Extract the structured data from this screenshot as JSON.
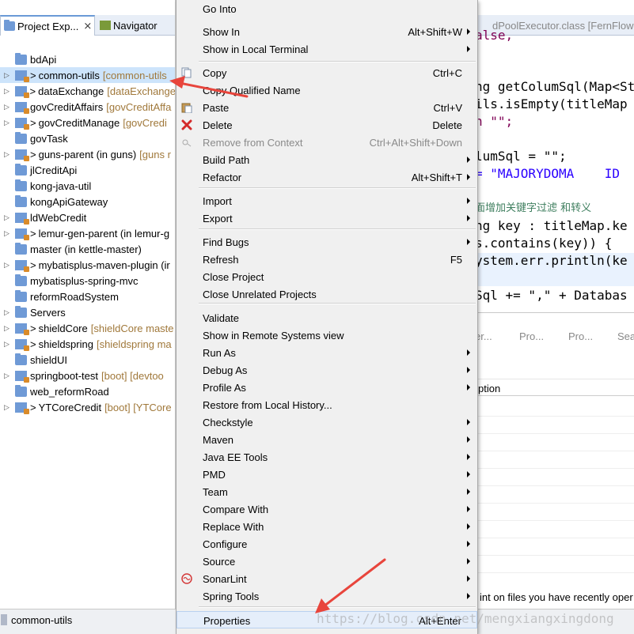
{
  "explorer": {
    "tab_project": "Project Exp...",
    "tab_close": "⨯",
    "tab_navigator": "Navigator",
    "items": [
      {
        "name": "bdApi",
        "extra": "",
        "gt": "",
        "expandable": false,
        "icon": "folder"
      },
      {
        "name": "common-utils",
        "extra": "[common-utils",
        "gt": ">",
        "expandable": true,
        "icon": "maven-project",
        "selected": true
      },
      {
        "name": "dataExchange",
        "extra": "[dataExchange",
        "gt": ">",
        "expandable": true,
        "icon": "maven-project"
      },
      {
        "name": "govCreditAffairs",
        "extra": "[govCreditAffa",
        "gt": "",
        "expandable": true,
        "icon": "maven-project"
      },
      {
        "name": "govCreditManage",
        "extra": "[govCredi",
        "gt": ">",
        "expandable": true,
        "icon": "maven-project"
      },
      {
        "name": "govTask",
        "extra": "",
        "gt": "",
        "expandable": false,
        "icon": "folder"
      },
      {
        "name": "guns-parent (in guns)",
        "extra": "[guns r",
        "gt": ">",
        "expandable": true,
        "icon": "maven-project"
      },
      {
        "name": "jlCreditApi",
        "extra": "",
        "gt": "",
        "expandable": false,
        "icon": "folder"
      },
      {
        "name": "kong-java-util",
        "extra": "",
        "gt": "",
        "expandable": false,
        "icon": "folder"
      },
      {
        "name": "kongApiGateway",
        "extra": "",
        "gt": "",
        "expandable": false,
        "icon": "folder"
      },
      {
        "name": "ldWebCredit",
        "extra": "",
        "gt": "",
        "expandable": true,
        "icon": "maven-project"
      },
      {
        "name": "lemur-gen-parent (in lemur-g",
        "extra": "",
        "gt": ">",
        "expandable": true,
        "icon": "maven-project"
      },
      {
        "name": "master (in kettle-master)",
        "extra": "",
        "gt": "",
        "expandable": false,
        "icon": "folder"
      },
      {
        "name": "mybatisplus-maven-plugin (ir",
        "extra": "",
        "gt": ">",
        "expandable": true,
        "icon": "maven-project"
      },
      {
        "name": "mybatisplus-spring-mvc",
        "extra": "",
        "gt": "",
        "expandable": false,
        "icon": "folder"
      },
      {
        "name": "reformRoadSystem",
        "extra": "",
        "gt": "",
        "expandable": false,
        "icon": "folder"
      },
      {
        "name": "Servers",
        "extra": "",
        "gt": "",
        "expandable": true,
        "icon": "folder"
      },
      {
        "name": "shieldCore",
        "extra": "[shieldCore maste",
        "gt": ">",
        "expandable": true,
        "icon": "maven-project"
      },
      {
        "name": "shieldspring",
        "extra": "[shieldspring ma",
        "gt": ">",
        "expandable": true,
        "icon": "maven-project"
      },
      {
        "name": "shieldUI",
        "extra": "",
        "gt": "",
        "expandable": false,
        "icon": "folder"
      },
      {
        "name": "springboot-test",
        "extra": "[boot] [devtoo",
        "gt": "",
        "expandable": true,
        "icon": "maven-project"
      },
      {
        "name": "web_reformRoad",
        "extra": "",
        "gt": "",
        "expandable": false,
        "icon": "folder"
      },
      {
        "name": "YTCoreCredit",
        "extra": "[boot] [YTCore",
        "gt": ">",
        "expandable": true,
        "icon": "maven-project"
      }
    ]
  },
  "editor": {
    "tab_label": "dPoolExecutor.class [FernFlower]",
    "lines": [
      {
        "text": "alse,",
        "color": "#7f0055"
      },
      {
        "text": "ng getColumSql(Map<St",
        "color": "#000000"
      },
      {
        "text": "ils.isEmpty(titleMap",
        "color": "#000000"
      },
      {
        "text": "n \"\";",
        "color": "#7f0055"
      },
      {
        "text": "lumSql = \"\";",
        "color": "#000000"
      },
      {
        "text": "= \"MAJORYDOMA    ID",
        "color": "#2a00ff"
      },
      {
        "text": "面增加关键字过滤 和转义",
        "color": "#3f7f5f"
      },
      {
        "text": "ng key : titleMap.ke",
        "color": "#000000"
      },
      {
        "text": "s.contains(key)) {",
        "color": "#000000"
      },
      {
        "text": "ystem.err.println(ke",
        "color": "#000000"
      },
      {
        "text": "Sql += \",\" + Databas",
        "color": "#000000"
      }
    ]
  },
  "lower_panel": {
    "tabs": [
      "er...",
      "Pro...",
      "Pro...",
      "Sea"
    ],
    "description_header": "ption",
    "sonar_tip": "int on files you have recently oper"
  },
  "status_bar": {
    "text": "common-utils"
  },
  "context_menu": {
    "items": [
      {
        "label": "Go Into",
        "shortcut": "",
        "submenu": false,
        "icon": ""
      },
      {
        "label": "Show In",
        "shortcut": "Alt+Shift+W",
        "submenu": true,
        "icon": ""
      },
      {
        "label": "Show in Local Terminal",
        "shortcut": "",
        "submenu": true,
        "icon": ""
      },
      {
        "label": "Copy",
        "shortcut": "Ctrl+C",
        "submenu": false,
        "icon": "copy-icon"
      },
      {
        "label": "Copy Qualified Name",
        "shortcut": "",
        "submenu": false,
        "icon": ""
      },
      {
        "label": "Paste",
        "shortcut": "Ctrl+V",
        "submenu": false,
        "icon": "paste-icon"
      },
      {
        "label": "Delete",
        "shortcut": "Delete",
        "submenu": false,
        "icon": "delete-icon"
      },
      {
        "label": "Remove from Context",
        "shortcut": "Ctrl+Alt+Shift+Down",
        "submenu": false,
        "icon": "remove-context-icon",
        "disabled": true
      },
      {
        "label": "Build Path",
        "shortcut": "",
        "submenu": true,
        "icon": ""
      },
      {
        "label": "Refactor",
        "shortcut": "Alt+Shift+T",
        "submenu": true,
        "icon": ""
      },
      {
        "label": "Import",
        "shortcut": "",
        "submenu": true,
        "icon": ""
      },
      {
        "label": "Export",
        "shortcut": "",
        "submenu": true,
        "icon": ""
      },
      {
        "label": "Find Bugs",
        "shortcut": "",
        "submenu": true,
        "icon": ""
      },
      {
        "label": "Refresh",
        "shortcut": "F5",
        "submenu": false,
        "icon": ""
      },
      {
        "label": "Close Project",
        "shortcut": "",
        "submenu": false,
        "icon": ""
      },
      {
        "label": "Close Unrelated Projects",
        "shortcut": "",
        "submenu": false,
        "icon": ""
      },
      {
        "label": "Validate",
        "shortcut": "",
        "submenu": false,
        "icon": ""
      },
      {
        "label": "Show in Remote Systems view",
        "shortcut": "",
        "submenu": false,
        "icon": ""
      },
      {
        "label": "Run As",
        "shortcut": "",
        "submenu": true,
        "icon": ""
      },
      {
        "label": "Debug As",
        "shortcut": "",
        "submenu": true,
        "icon": ""
      },
      {
        "label": "Profile As",
        "shortcut": "",
        "submenu": true,
        "icon": ""
      },
      {
        "label": "Restore from Local History...",
        "shortcut": "",
        "submenu": false,
        "icon": ""
      },
      {
        "label": "Checkstyle",
        "shortcut": "",
        "submenu": true,
        "icon": ""
      },
      {
        "label": "Maven",
        "shortcut": "",
        "submenu": true,
        "icon": ""
      },
      {
        "label": "Java EE Tools",
        "shortcut": "",
        "submenu": true,
        "icon": ""
      },
      {
        "label": "PMD",
        "shortcut": "",
        "submenu": true,
        "icon": ""
      },
      {
        "label": "Team",
        "shortcut": "",
        "submenu": true,
        "icon": ""
      },
      {
        "label": "Compare With",
        "shortcut": "",
        "submenu": true,
        "icon": ""
      },
      {
        "label": "Replace With",
        "shortcut": "",
        "submenu": true,
        "icon": ""
      },
      {
        "label": "Configure",
        "shortcut": "",
        "submenu": true,
        "icon": ""
      },
      {
        "label": "Source",
        "shortcut": "",
        "submenu": true,
        "icon": ""
      },
      {
        "label": "SonarLint",
        "shortcut": "",
        "submenu": true,
        "icon": "sonarlint-icon"
      },
      {
        "label": "Spring Tools",
        "shortcut": "",
        "submenu": true,
        "icon": ""
      },
      {
        "label": "Properties",
        "shortcut": "Alt+Enter",
        "submenu": false,
        "icon": "",
        "hover": true
      }
    ]
  },
  "watermark": "https://blog.csdn.net/mengxiangxingdong",
  "colors": {
    "annotation_arrow": "#e8453c",
    "selection": "#cde4fb",
    "menu_background": "#f0f0f0"
  }
}
